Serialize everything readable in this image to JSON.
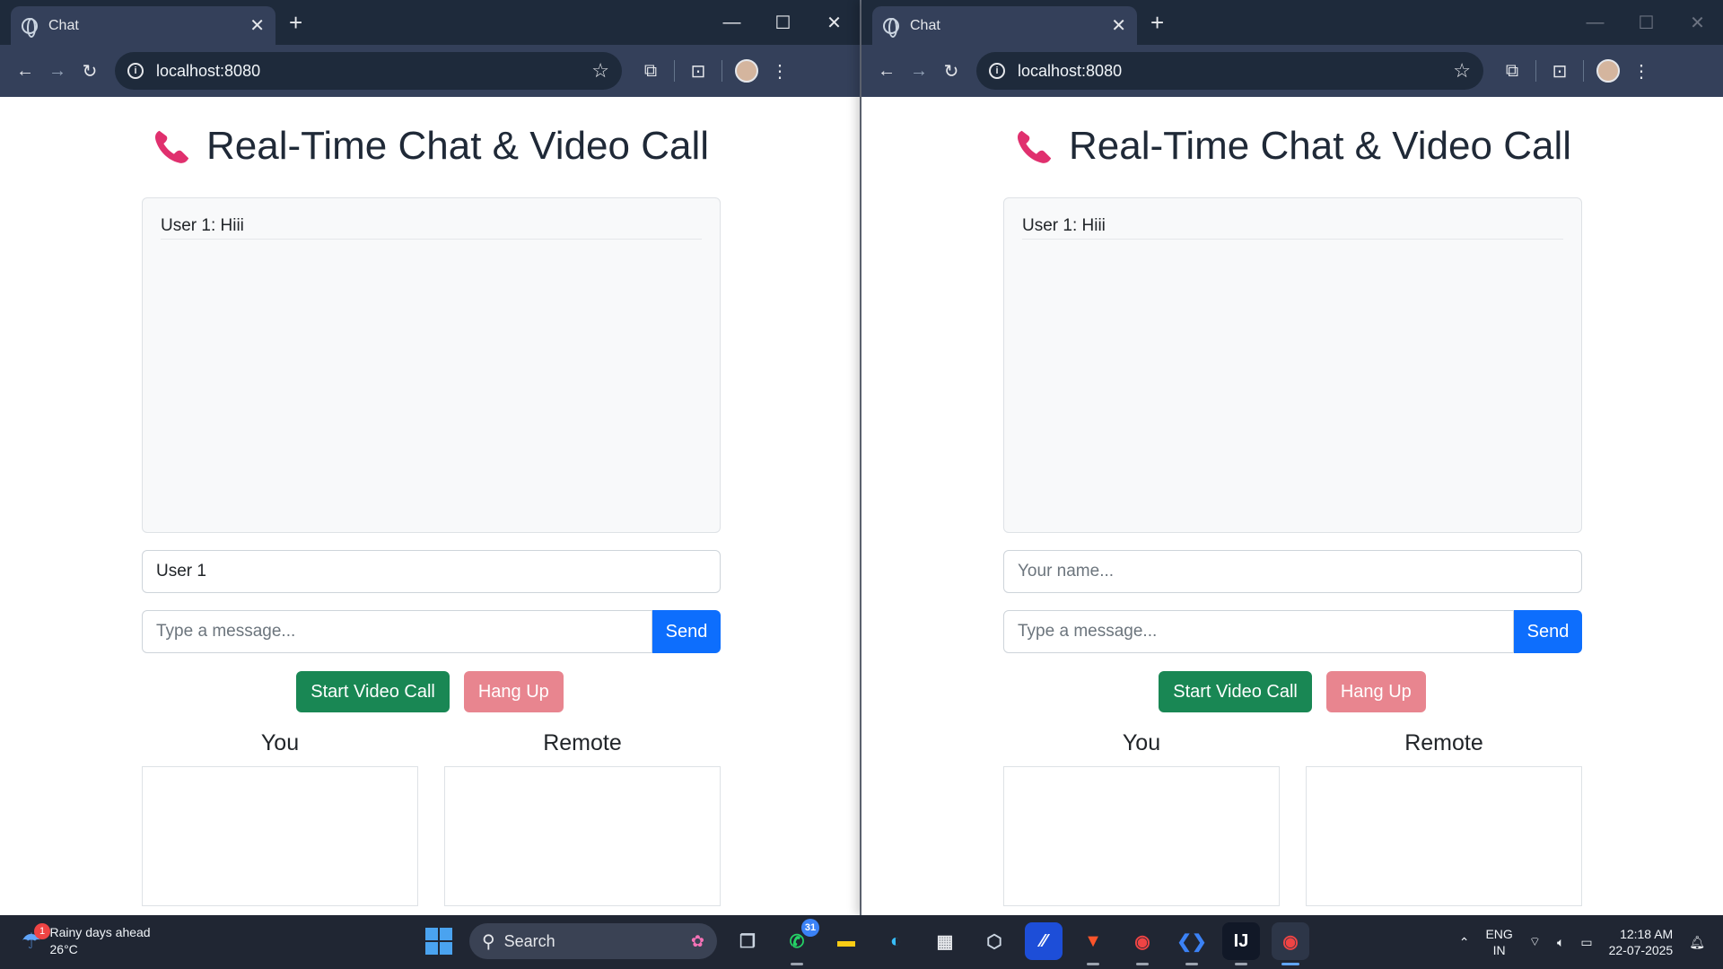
{
  "browser": {
    "tab_title": "Chat",
    "url": "localhost:8080",
    "new_tab": "+",
    "tab_close": "✕"
  },
  "page": {
    "heading": "Real-Time Chat & Video Call",
    "messages": [
      "User 1: Hiii"
    ],
    "name_value_left": "User 1",
    "name_placeholder": "Your name...",
    "message_placeholder": "Type a message...",
    "send_label": "Send",
    "start_call_label": "Start Video Call",
    "hangup_label": "Hang Up",
    "you_label": "You",
    "remote_label": "Remote"
  },
  "colors": {
    "send": "#0d6efd",
    "start_call": "#198754",
    "hangup": "#e8858f"
  },
  "taskbar": {
    "weather_title": "Rainy days ahead",
    "weather_temp": "26°C",
    "weather_badge": "1",
    "search_label": "Search",
    "whatsapp_badge": "31",
    "language": "ENG",
    "region": "IN",
    "time": "12:18 AM",
    "date": "22-07-2025"
  }
}
